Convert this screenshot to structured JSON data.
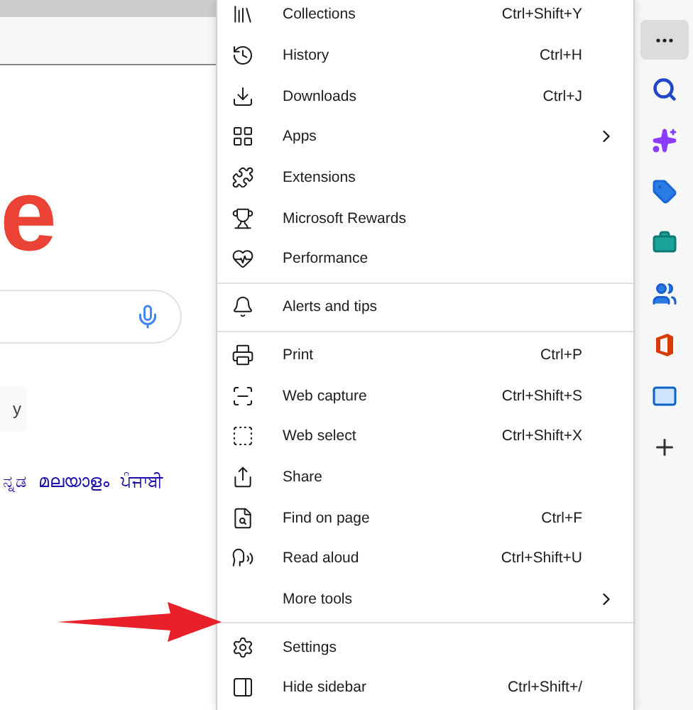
{
  "page": {
    "logo_fragment": "e",
    "button_fragment": "y",
    "languages": [
      "ನ್ನಡ",
      "മലയാളം",
      "ਪੰਜਾਬੀ"
    ]
  },
  "menu": {
    "items": [
      {
        "kind": "item",
        "label": "Collections",
        "shortcut": "Ctrl+Shift+Y",
        "submenu": false
      },
      {
        "kind": "item",
        "label": "History",
        "shortcut": "Ctrl+H",
        "submenu": false
      },
      {
        "kind": "item",
        "label": "Downloads",
        "shortcut": "Ctrl+J",
        "submenu": false
      },
      {
        "kind": "item",
        "label": "Apps",
        "submenu": true
      },
      {
        "kind": "item",
        "label": "Extensions",
        "submenu": false
      },
      {
        "kind": "item",
        "label": "Microsoft Rewards",
        "submenu": false
      },
      {
        "kind": "item",
        "label": "Performance",
        "submenu": false
      },
      {
        "kind": "separator"
      },
      {
        "kind": "item",
        "label": "Alerts and tips",
        "submenu": false
      },
      {
        "kind": "separator"
      },
      {
        "kind": "item",
        "label": "Print",
        "shortcut": "Ctrl+P",
        "submenu": false
      },
      {
        "kind": "item",
        "label": "Web capture",
        "shortcut": "Ctrl+Shift+S",
        "submenu": false
      },
      {
        "kind": "item",
        "label": "Web select",
        "shortcut": "Ctrl+Shift+X",
        "submenu": false
      },
      {
        "kind": "item",
        "label": "Share",
        "submenu": false
      },
      {
        "kind": "item",
        "label": "Find on page",
        "shortcut": "Ctrl+F",
        "submenu": false
      },
      {
        "kind": "item",
        "label": "Read aloud",
        "shortcut": "Ctrl+Shift+U",
        "submenu": false
      },
      {
        "kind": "item",
        "label": "More tools",
        "submenu": true
      },
      {
        "kind": "separator"
      },
      {
        "kind": "item",
        "label": "Settings",
        "submenu": false
      },
      {
        "kind": "item",
        "label": "Hide sidebar",
        "shortcut": "Ctrl+Shift+/",
        "submenu": false
      }
    ]
  }
}
